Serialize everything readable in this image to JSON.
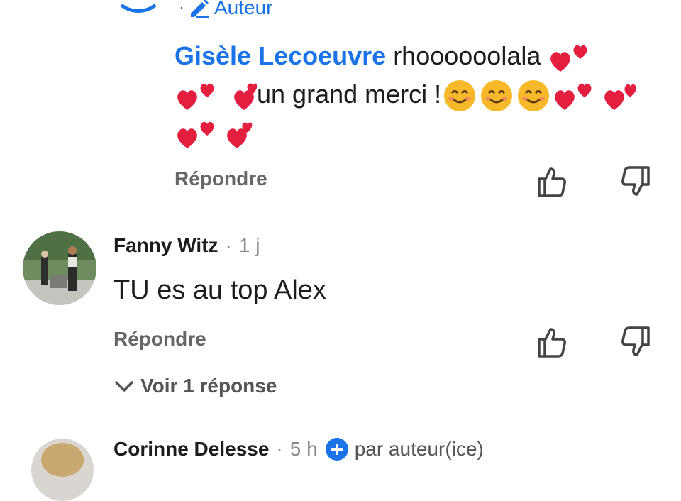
{
  "top_reply": {
    "badge_label": "Auteur",
    "author": "Gisèle Lecoeuvre",
    "text_line1": "rhoooooolala",
    "text_line2": "un grand merci !",
    "reply_label": "Répondre"
  },
  "comment": {
    "author": "Fanny Witz",
    "time": "1 j",
    "text": "TU es au top Alex",
    "reply_label": "Répondre",
    "see_replies_label": "Voir 1 réponse"
  },
  "bottom_comment": {
    "author": "Corinne Delesse",
    "time": "5 h",
    "badge_label": "par auteur(ice)"
  },
  "icons": [
    "thumbs-up-icon",
    "thumbs-down-icon",
    "pencil-icon",
    "chevron-down-icon",
    "red-hearts-emoji",
    "smiling-face-emoji"
  ],
  "colors": {
    "accent": "#1a73e8",
    "heart": "#e41e3f",
    "emoji_face": "#f7b829"
  }
}
